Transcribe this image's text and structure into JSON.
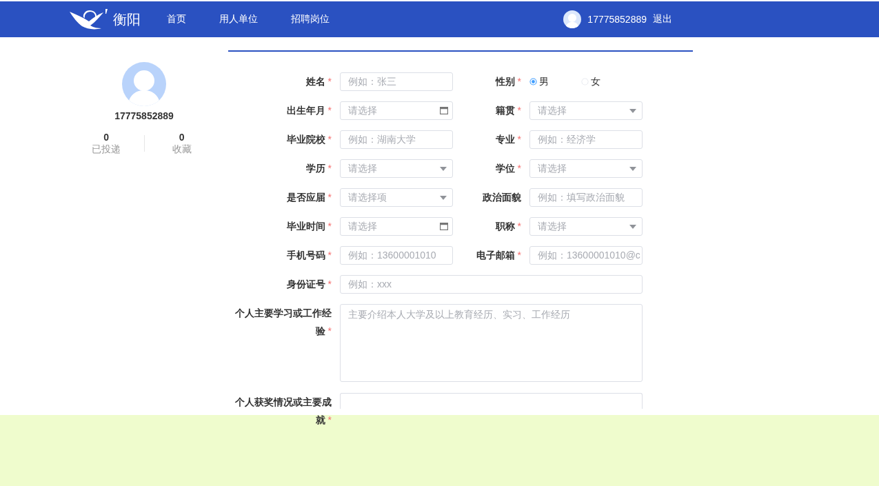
{
  "header": {
    "brand": "衡阳",
    "nav": [
      {
        "label": "首页"
      },
      {
        "label": "用人单位"
      },
      {
        "label": "招聘岗位"
      }
    ],
    "user": "17775852889",
    "logout": "退出"
  },
  "profile": {
    "phone": "17775852889",
    "stats": [
      {
        "count": "0",
        "label": "已投递"
      },
      {
        "count": "0",
        "label": "收藏"
      }
    ]
  },
  "form": {
    "rows": [
      {
        "fields": [
          {
            "label": "姓名",
            "mark": "*",
            "kind": "text",
            "placeholder": "例如：张三"
          },
          {
            "label": "性别",
            "mark": "*",
            "kind": "radio",
            "options": [
              {
                "label": "男",
                "selected": true
              },
              {
                "label": "女",
                "selected": false
              }
            ]
          }
        ]
      },
      {
        "fields": [
          {
            "label": "出生年月",
            "mark": "*",
            "kind": "date",
            "placeholder": "请选择"
          },
          {
            "label": "籍贯",
            "mark": "*",
            "kind": "select",
            "placeholder": "请选择"
          }
        ]
      },
      {
        "fields": [
          {
            "label": "毕业院校",
            "mark": "*",
            "kind": "text",
            "placeholder": "例如：湖南大学"
          },
          {
            "label": "专业",
            "mark": "*",
            "kind": "text",
            "placeholder": "例如：经济学"
          }
        ]
      },
      {
        "fields": [
          {
            "label": "学历",
            "mark": "*",
            "kind": "select",
            "placeholder": "请选择"
          },
          {
            "label": "学位",
            "mark": "*",
            "kind": "select",
            "placeholder": "请选择"
          }
        ]
      },
      {
        "fields": [
          {
            "label": "是否应届",
            "mark": "*",
            "kind": "select",
            "placeholder": "请选择项"
          },
          {
            "label": "政治面貌",
            "kind": "text",
            "placeholder": "例如：填写政治面貌"
          }
        ]
      },
      {
        "fields": [
          {
            "label": "毕业时间",
            "mark": "*",
            "kind": "date",
            "placeholder": "请选择"
          },
          {
            "label": "职称",
            "mark": "*",
            "kind": "select",
            "placeholder": "请选择"
          }
        ]
      },
      {
        "fields": [
          {
            "label": "手机号码",
            "mark": "*",
            "kind": "text",
            "placeholder": "例如：13600001010"
          },
          {
            "label": "电子邮箱",
            "mark": "*",
            "kind": "text",
            "placeholder": "例如：13600001010@c"
          }
        ]
      },
      {
        "fields": [
          {
            "label": "身份证号",
            "mark": "*",
            "kind": "text",
            "placeholder": "例如：xxx"
          }
        ]
      },
      {
        "fields": [
          {
            "label": "个人主要学习或工作经验",
            "mark": "*",
            "kind": "textarea",
            "placeholder": "主要介绍本人大学及以上教育经历、实习、工作经历"
          }
        ]
      },
      {
        "fields": [
          {
            "label": "个人获奖情况或主要成就",
            "mark": "*",
            "kind": "textarea"
          }
        ]
      }
    ]
  }
}
